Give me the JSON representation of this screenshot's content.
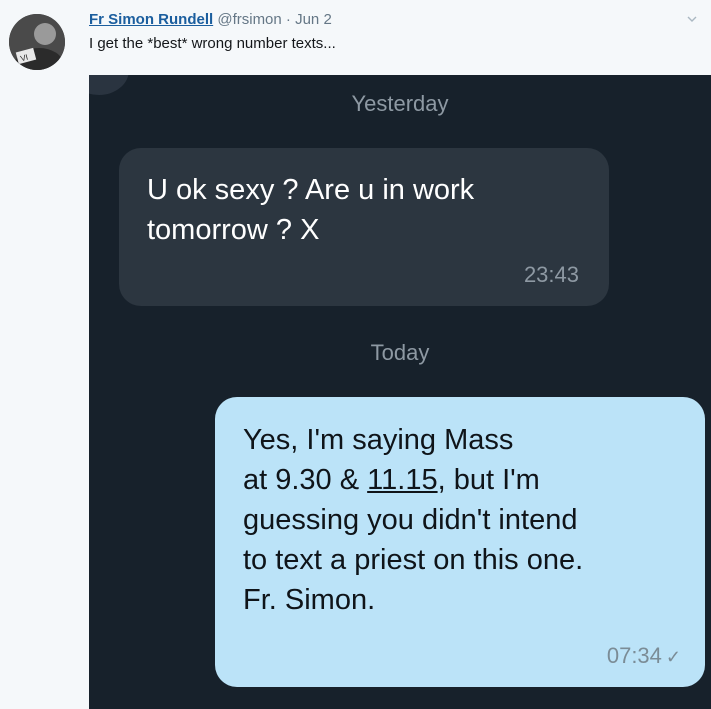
{
  "tweet": {
    "author_name": "Fr Simon Rundell",
    "handle": "@frsimon",
    "separator": "·",
    "date": "Jun 2",
    "text": "I get the *best* wrong number texts..."
  },
  "conversation": {
    "date_yesterday": "Yesterday",
    "incoming": {
      "line1": "U ok sexy ? Are u in work",
      "line2": "tomorrow ? X",
      "time": "23:43"
    },
    "date_today": "Today",
    "outgoing": {
      "line1": "Yes, I'm saying Mass",
      "line2_pre": "at 9.30 & ",
      "line2_link": "11.15",
      "line2_post": ", but I'm",
      "line3": "guessing you didn't intend",
      "line4": "to text a priest on this one.",
      "line5": "Fr. Simon.",
      "time": "07:34",
      "status_icon": "single-check-icon"
    }
  }
}
